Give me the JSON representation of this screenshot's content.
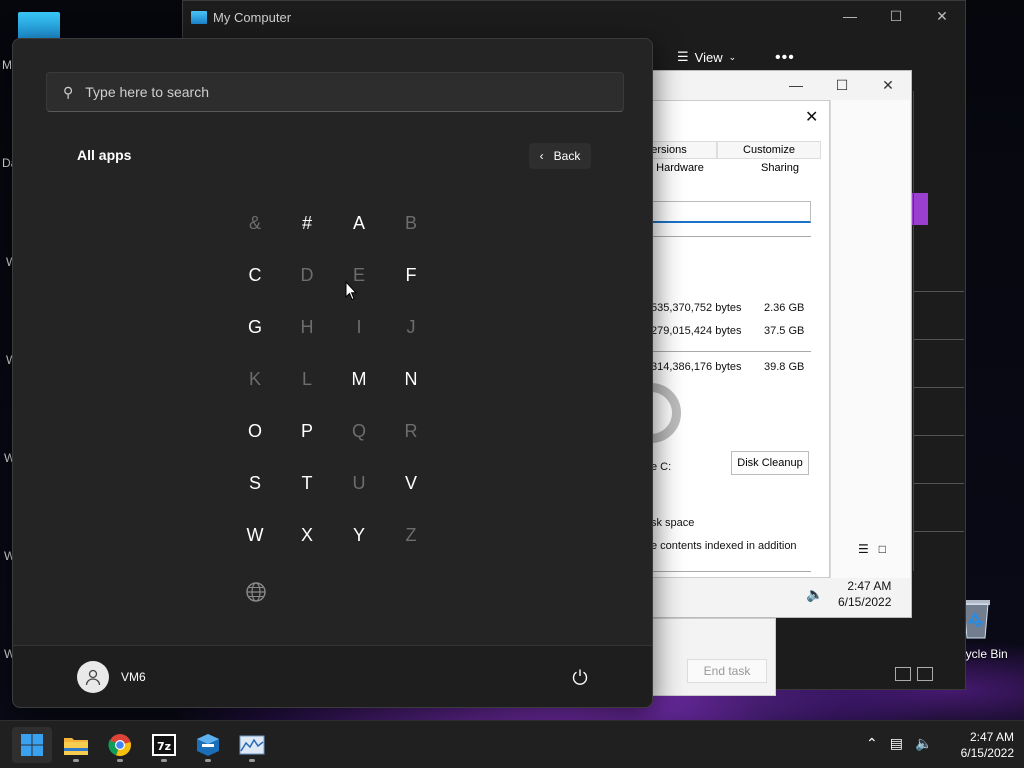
{
  "desktop": {
    "left_letters": [
      "M",
      "Da",
      "W",
      "W",
      "W",
      "W",
      "W"
    ],
    "recycle_bin_label": "Recycle Bin"
  },
  "my_computer": {
    "title": "My Computer",
    "view_label": "View",
    "more_label": "•••"
  },
  "properties": {
    "tabs_row1": [
      "ersions",
      "Customize"
    ],
    "tabs_row2": [
      "Hardware",
      "Sharing"
    ],
    "used_bytes": "535,370,752 bytes",
    "used_size": "2.36 GB",
    "free_bytes": "279,015,424 bytes",
    "free_size": "37.5 GB",
    "capacity_bytes": "314,386,176 bytes",
    "capacity_size": "39.8 GB",
    "drive_label": "e C:",
    "disk_cleanup_label": "Disk Cleanup",
    "compress_text": "sk space",
    "index_text": "e contents indexed in addition"
  },
  "background_window": {
    "clock_time": "2:47 AM",
    "clock_date": "6/15/2022"
  },
  "task_manager": {
    "end_task_label": "End task"
  },
  "start_menu": {
    "search_placeholder": "Type here to search",
    "section_title": "All apps",
    "back_label": "Back",
    "letters": [
      {
        "char": "&",
        "enabled": false
      },
      {
        "char": "#",
        "enabled": true
      },
      {
        "char": "A",
        "enabled": true
      },
      {
        "char": "B",
        "enabled": false
      },
      {
        "char": "C",
        "enabled": true
      },
      {
        "char": "D",
        "enabled": false
      },
      {
        "char": "E",
        "enabled": false
      },
      {
        "char": "F",
        "enabled": true
      },
      {
        "char": "G",
        "enabled": true
      },
      {
        "char": "H",
        "enabled": false
      },
      {
        "char": "I",
        "enabled": false
      },
      {
        "char": "J",
        "enabled": false
      },
      {
        "char": "K",
        "enabled": false
      },
      {
        "char": "L",
        "enabled": false
      },
      {
        "char": "M",
        "enabled": true
      },
      {
        "char": "N",
        "enabled": true
      },
      {
        "char": "O",
        "enabled": true
      },
      {
        "char": "P",
        "enabled": true
      },
      {
        "char": "Q",
        "enabled": false
      },
      {
        "char": "R",
        "enabled": false
      },
      {
        "char": "S",
        "enabled": true
      },
      {
        "char": "T",
        "enabled": true
      },
      {
        "char": "U",
        "enabled": false
      },
      {
        "char": "V",
        "enabled": true
      },
      {
        "char": "W",
        "enabled": true
      },
      {
        "char": "X",
        "enabled": true
      },
      {
        "char": "Y",
        "enabled": true
      },
      {
        "char": "Z",
        "enabled": false
      }
    ],
    "user_name": "VM6"
  },
  "taskbar": {
    "apps": [
      "start-icon",
      "file-explorer-icon",
      "chrome-icon",
      "7zip-icon",
      "virtualbox-icon",
      "system-monitor-icon"
    ],
    "clock_time": "2:47 AM",
    "clock_date": "6/15/2022"
  },
  "colors": {
    "start_bg": "#242424",
    "accent_blue": "#1a73c9",
    "taskbar_bg": "#202020"
  }
}
